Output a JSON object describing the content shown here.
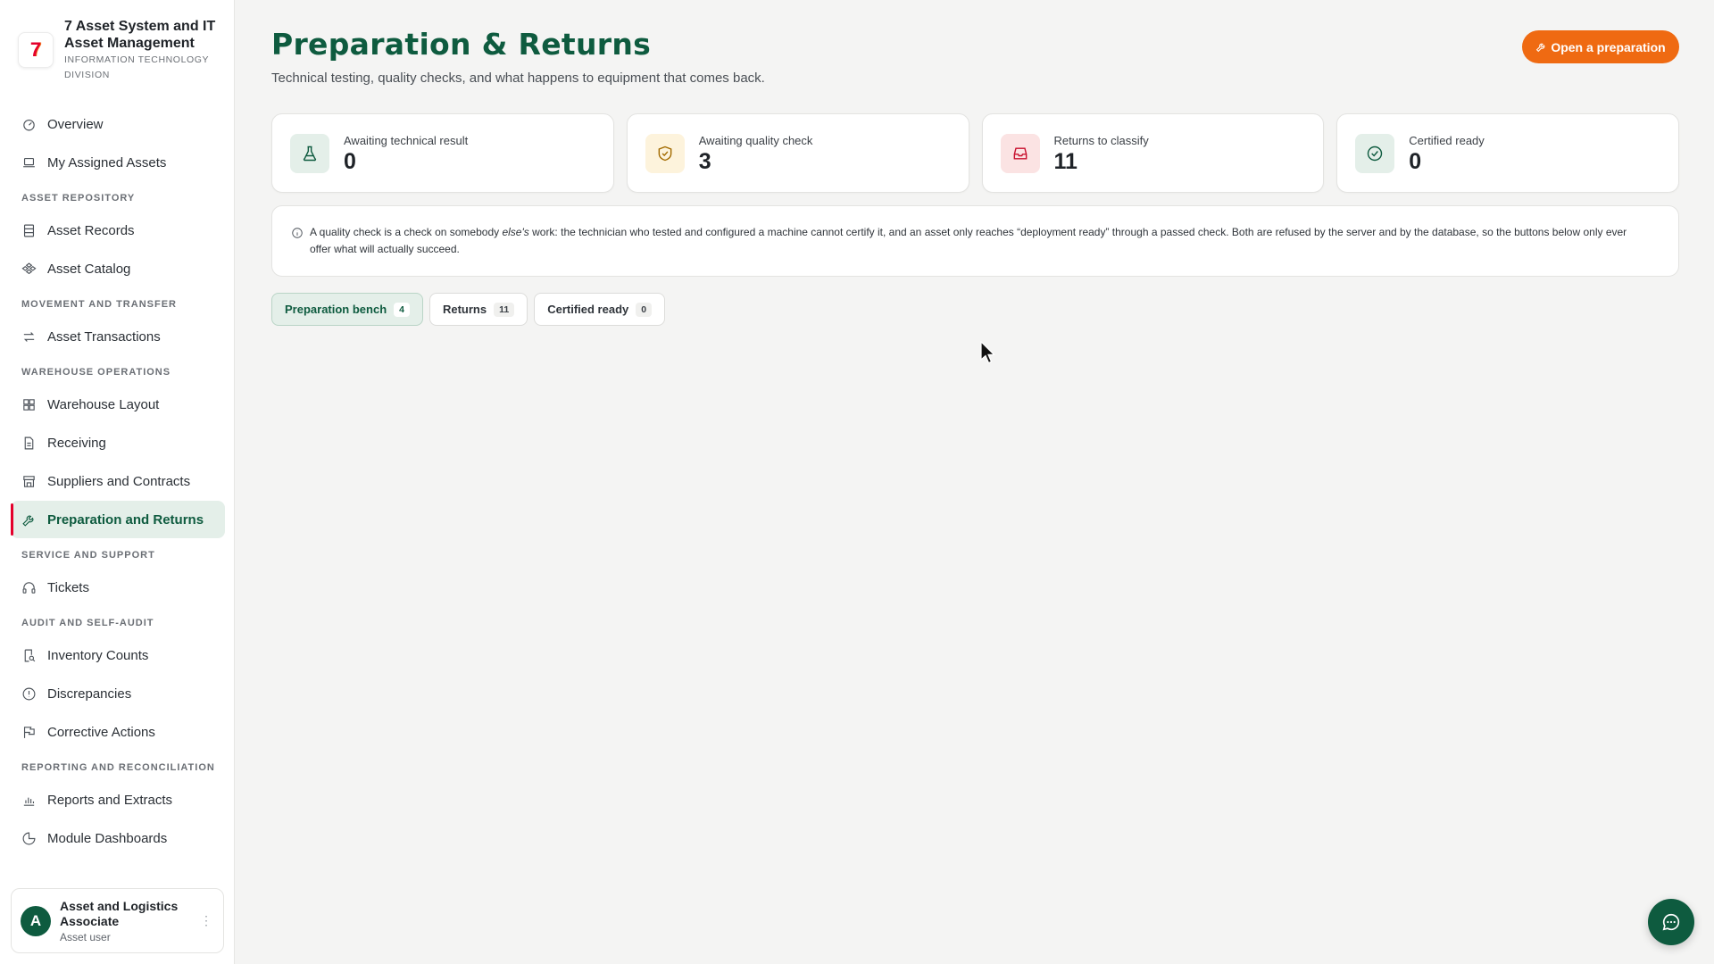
{
  "app": {
    "logo_text": "7",
    "title": "7 Asset System and IT Asset Management",
    "division": "INFORMATION TECHNOLOGY DIVISION"
  },
  "sidebar": {
    "items": [
      {
        "type": "item",
        "label": "Overview",
        "icon": "dashboard-icon"
      },
      {
        "type": "item",
        "label": "My Assigned Assets",
        "icon": "laptop-icon"
      },
      {
        "type": "section",
        "label": "ASSET REPOSITORY"
      },
      {
        "type": "item",
        "label": "Asset Records",
        "icon": "records-icon"
      },
      {
        "type": "item",
        "label": "Asset Catalog",
        "icon": "catalog-icon"
      },
      {
        "type": "section",
        "label": "MOVEMENT AND TRANSFER"
      },
      {
        "type": "item",
        "label": "Asset Transactions",
        "icon": "transfer-icon"
      },
      {
        "type": "section",
        "label": "WAREHOUSE OPERATIONS"
      },
      {
        "type": "item",
        "label": "Warehouse Layout",
        "icon": "grid-icon"
      },
      {
        "type": "item",
        "label": "Receiving",
        "icon": "document-icon"
      },
      {
        "type": "item",
        "label": "Suppliers and Contracts",
        "icon": "store-icon"
      },
      {
        "type": "item",
        "label": "Preparation and Returns",
        "icon": "wrench-icon",
        "active": true
      },
      {
        "type": "section",
        "label": "SERVICE AND SUPPORT"
      },
      {
        "type": "item",
        "label": "Tickets",
        "icon": "headset-icon"
      },
      {
        "type": "section",
        "label": "AUDIT AND SELF-AUDIT"
      },
      {
        "type": "item",
        "label": "Inventory Counts",
        "icon": "search-document-icon"
      },
      {
        "type": "item",
        "label": "Discrepancies",
        "icon": "alert-circle-icon"
      },
      {
        "type": "item",
        "label": "Corrective Actions",
        "icon": "flag-icon"
      },
      {
        "type": "section",
        "label": "REPORTING AND RECONCILIATION"
      },
      {
        "type": "item",
        "label": "Reports and Extracts",
        "icon": "bar-chart-icon"
      },
      {
        "type": "item",
        "label": "Module Dashboards",
        "icon": "pie-chart-icon"
      }
    ]
  },
  "user": {
    "initial": "A",
    "name": "Asset and Logistics Associate",
    "role": "Asset user",
    "more_glyph": "⋮"
  },
  "header": {
    "title": "Preparation & Returns",
    "subtitle": "Technical testing, quality checks, and what happens to equipment that comes back.",
    "primary_action": "Open a preparation"
  },
  "stats": [
    {
      "label": "Awaiting technical result",
      "value": "0",
      "icon": "flask-icon",
      "bg": "#e4efe9",
      "color": "#0e5b3f"
    },
    {
      "label": "Awaiting quality check",
      "value": "3",
      "icon": "shield-check-icon",
      "bg": "#fdf3dc",
      "color": "#a36b00"
    },
    {
      "label": "Returns to classify",
      "value": "11",
      "icon": "inbox-icon",
      "bg": "#fbe3e3",
      "color": "#c8102e"
    },
    {
      "label": "Certified ready",
      "value": "0",
      "icon": "check-circle-icon",
      "bg": "#e4efe9",
      "color": "#0e5b3f"
    }
  ],
  "notice": {
    "prefix": "A quality check is a check on somebody ",
    "emphasis": "else's",
    "suffix": " work: the technician who tested and configured a machine cannot certify it, and an asset only reaches “deployment ready” through a passed check. Both are refused by the server and by the database, so the buttons below only ever offer what will actually succeed."
  },
  "tabs": [
    {
      "label": "Preparation bench",
      "count": "4",
      "active": true
    },
    {
      "label": "Returns",
      "count": "11",
      "active": false
    },
    {
      "label": "Certified ready",
      "count": "0",
      "active": false
    }
  ],
  "colors": {
    "brand_green": "#0e5b3f",
    "accent_orange": "#ef6a12",
    "active_marker_red": "#e4002b"
  }
}
